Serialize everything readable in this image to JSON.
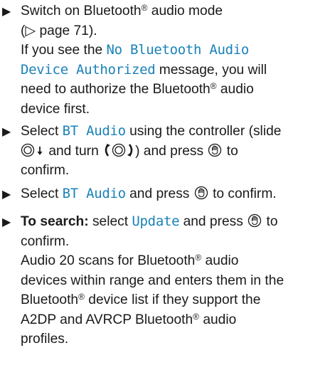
{
  "steps": [
    {
      "lines": [
        {
          "segments": [
            {
              "text": "Switch on Bluetooth"
            },
            {
              "sup": "®"
            },
            {
              "text": " audio mode"
            }
          ]
        },
        {
          "segments": [
            {
              "text": "(▷ page 71)."
            }
          ]
        },
        {
          "segments": [
            {
              "text": "If you see the "
            },
            {
              "mono": "No Bluetooth Audio"
            }
          ]
        },
        {
          "segments": [
            {
              "mono": "Device Authorized"
            },
            {
              "text": " message, you will"
            }
          ]
        },
        {
          "segments": [
            {
              "text": "need to authorize the Bluetooth"
            },
            {
              "sup": "®"
            },
            {
              "text": " audio"
            }
          ]
        },
        {
          "segments": [
            {
              "text": "device first."
            }
          ]
        }
      ]
    },
    {
      "lines": [
        {
          "segments": [
            {
              "text": "Select "
            },
            {
              "mono": "BT Audio"
            },
            {
              "text": " using the controller (slide"
            }
          ]
        },
        {
          "segments": [
            {
              "icon": "controller-slide-down-icon"
            },
            {
              "text": " and turn "
            },
            {
              "icon": "controller-turn-icon"
            },
            {
              "text": ") and press "
            },
            {
              "icon": "controller-press-icon"
            },
            {
              "text": " to"
            }
          ]
        },
        {
          "segments": [
            {
              "text": "confirm."
            }
          ]
        }
      ]
    },
    {
      "lines": [
        {
          "segments": [
            {
              "text": "Select "
            },
            {
              "mono": "BT Audio"
            },
            {
              "text": " and press "
            },
            {
              "icon": "controller-press-icon"
            },
            {
              "text": " to confirm."
            }
          ]
        }
      ]
    },
    {
      "lines": [
        {
          "segments": [
            {
              "bold": "To search:"
            },
            {
              "text": " select "
            },
            {
              "mono": "Update"
            },
            {
              "text": " and press "
            },
            {
              "icon": "controller-press-icon"
            },
            {
              "text": " to"
            }
          ]
        },
        {
          "segments": [
            {
              "text": "confirm."
            }
          ]
        },
        {
          "segments": [
            {
              "text": "Audio 20 scans for Bluetooth"
            },
            {
              "sup": "®"
            },
            {
              "text": " audio"
            }
          ]
        },
        {
          "segments": [
            {
              "text": "devices within range and enters them in the"
            }
          ]
        },
        {
          "segments": [
            {
              "text": "Bluetooth"
            },
            {
              "sup": "®"
            },
            {
              "text": " device list if they support the"
            }
          ]
        },
        {
          "segments": [
            {
              "text": "A2DP and AVRCP Bluetooth"
            },
            {
              "sup": "®"
            },
            {
              "text": " audio"
            }
          ]
        },
        {
          "segments": [
            {
              "text": "profiles."
            }
          ]
        }
      ]
    }
  ],
  "bullet_glyph": "▶",
  "colors": {
    "highlight": "#1a82b8",
    "text": "#1a1a1a"
  }
}
